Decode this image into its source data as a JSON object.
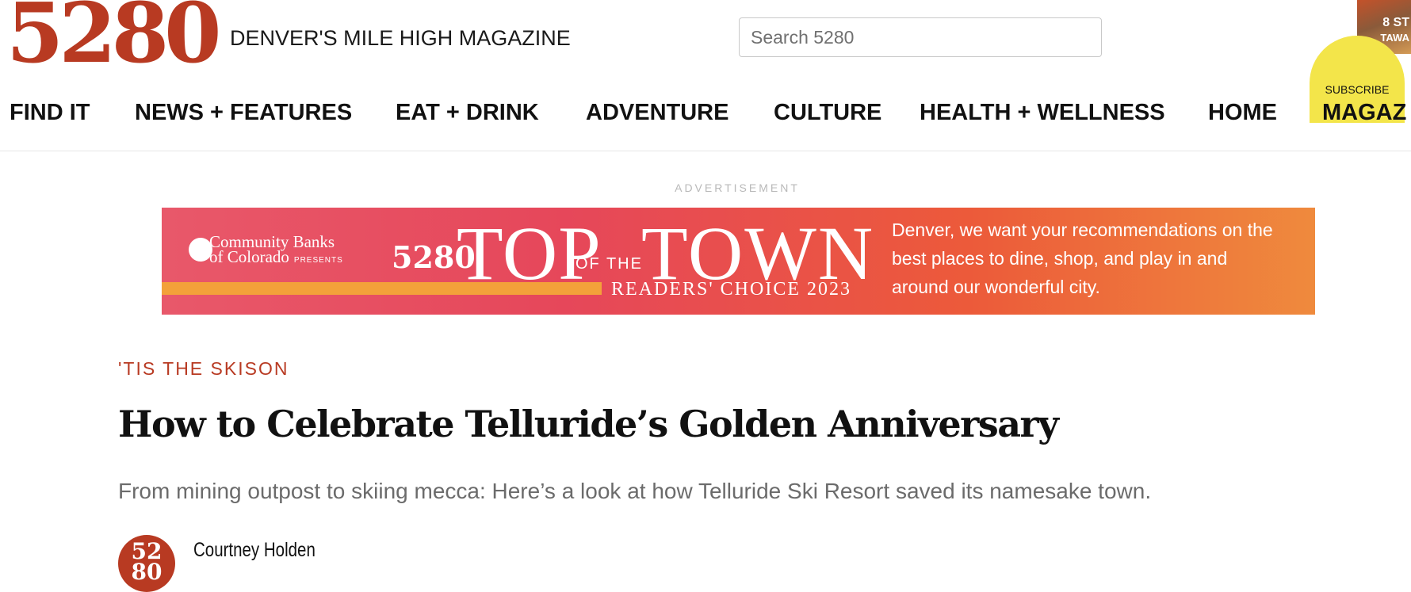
{
  "header": {
    "logo_text": "5280",
    "tagline": "DENVER'S MILE HIGH MAGAZINE",
    "search_placeholder": "Search 5280",
    "subscribe_label": "SUBSCRIBE",
    "promo_cover_text": "8 ST",
    "promo_cover_text2": "TAWA"
  },
  "nav": {
    "items": [
      "FIND IT",
      "NEWS + FEATURES",
      "EAT + DRINK",
      "ADVENTURE",
      "CULTURE",
      "HEALTH + WELLNESS",
      "HOME",
      "MAGAZ"
    ]
  },
  "advertisement": {
    "label": "ADVERTISEMENT",
    "sponsor_line1": "Community Banks",
    "sponsor_line2": "of Colorado",
    "sponsor_presents": "PRESENTS",
    "brand": "5280",
    "headline_top": "TOP",
    "headline_ofthe": "OF THE",
    "headline_town": "TOWN",
    "subhead": "READERS' CHOICE 2023",
    "copy": "Denver, we want your recommendations on the best places to dine, shop, and play in and around our wonderful city."
  },
  "article": {
    "kicker": "'TIS THE SKISON",
    "title": "How to Celebrate Telluride’s Golden Anniversary",
    "dek": "From mining outpost to skiing mecca: Here’s a look at how Telluride Ski Resort saved its namesake town.",
    "author": "Courtney Holden",
    "avatar_text_top": "52",
    "avatar_text_bottom": "80"
  },
  "colors": {
    "brand_red": "#b83a22",
    "subscribe_yellow": "#f3e54a",
    "ad_gradient_start": "#e8586a",
    "ad_gradient_end": "#ef8a3d"
  }
}
